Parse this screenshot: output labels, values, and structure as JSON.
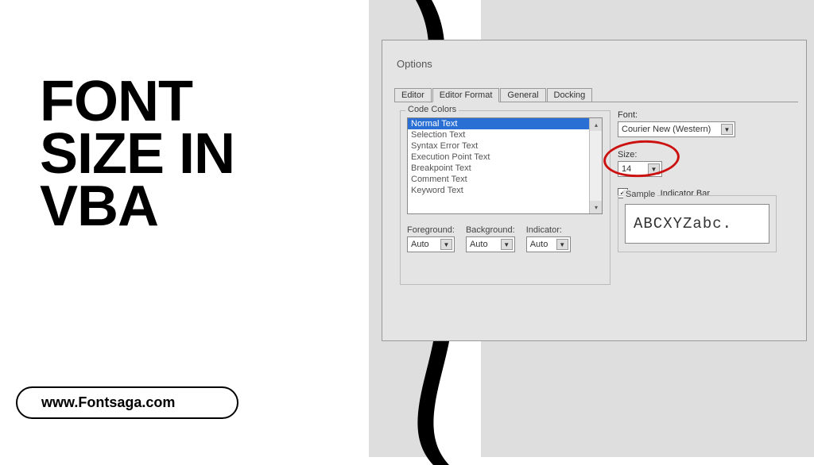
{
  "hero": {
    "line1": "FONT",
    "line2": "SIZE IN",
    "line3": "VBA"
  },
  "website": "www.Fontsaga.com",
  "dialog": {
    "title": "Options",
    "tabs": {
      "editor": "Editor",
      "editor_format": "Editor Format",
      "general": "General",
      "docking": "Docking"
    },
    "code_colors": {
      "group_label": "Code Colors",
      "items": [
        "Normal Text",
        "Selection Text",
        "Syntax Error Text",
        "Execution Point Text",
        "Breakpoint Text",
        "Comment Text",
        "Keyword Text"
      ],
      "selected_index": 0
    },
    "foreground": {
      "label": "Foreground:",
      "value": "Auto"
    },
    "background": {
      "label": "Background:",
      "value": "Auto"
    },
    "indicator": {
      "label": "Indicator:",
      "value": "Auto"
    },
    "font": {
      "label": "Font:",
      "value": "Courier New (Western)"
    },
    "size": {
      "label": "Size:",
      "value": "14"
    },
    "margin_indicator": {
      "label": "Margin Indicator Bar",
      "checked": true
    },
    "sample": {
      "group_label": "Sample",
      "text": "ABCXYZabc."
    }
  }
}
